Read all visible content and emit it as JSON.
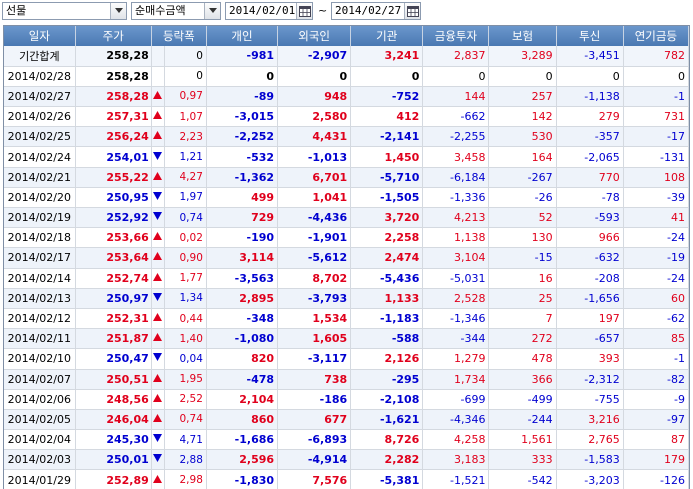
{
  "toolbar": {
    "market_select": "선물",
    "metric_select": "순매수금액",
    "date_from": "2014/02/01",
    "date_separator": "~",
    "date_to": "2014/02/27"
  },
  "colors": {
    "up": "#e0001c",
    "down": "#0000d0",
    "header": "#4f81bd"
  },
  "columns": [
    "일자",
    "주가",
    "등락폭",
    "개인",
    "외국인",
    "기관",
    "금융투자",
    "보험",
    "투신",
    "연기금등"
  ],
  "rows": [
    {
      "date": "기간합계",
      "price": "258,28",
      "dir": "",
      "chg": "0",
      "ind": "-981",
      "for": "-2,907",
      "inst": "3,241",
      "fin": "2,837",
      "ins": "3,289",
      "tru": "-3,451",
      "pen": "782",
      "sum": true
    },
    {
      "date": "2014/02/28",
      "price": "258,28",
      "dir": "",
      "chg": "0",
      "ind": "0",
      "for": "0",
      "inst": "0",
      "fin": "0",
      "ins": "0",
      "tru": "0",
      "pen": "0"
    },
    {
      "date": "2014/02/27",
      "price": "258,28",
      "dir": "up",
      "chg": "0,97",
      "ind": "-89",
      "for": "948",
      "inst": "-752",
      "fin": "144",
      "ins": "257",
      "tru": "-1,138",
      "pen": "-1"
    },
    {
      "date": "2014/02/26",
      "price": "257,31",
      "dir": "up",
      "chg": "1,07",
      "ind": "-3,015",
      "for": "2,580",
      "inst": "412",
      "fin": "-662",
      "ins": "142",
      "tru": "279",
      "pen": "731"
    },
    {
      "date": "2014/02/25",
      "price": "256,24",
      "dir": "up",
      "chg": "2,23",
      "ind": "-2,252",
      "for": "4,431",
      "inst": "-2,141",
      "fin": "-2,255",
      "ins": "530",
      "tru": "-357",
      "pen": "-17"
    },
    {
      "date": "2014/02/24",
      "price": "254,01",
      "dir": "down",
      "chg": "1,21",
      "ind": "-532",
      "for": "-1,013",
      "inst": "1,450",
      "fin": "3,458",
      "ins": "164",
      "tru": "-2,065",
      "pen": "-131"
    },
    {
      "date": "2014/02/21",
      "price": "255,22",
      "dir": "up",
      "chg": "4,27",
      "ind": "-1,362",
      "for": "6,701",
      "inst": "-5,710",
      "fin": "-6,184",
      "ins": "-267",
      "tru": "770",
      "pen": "108"
    },
    {
      "date": "2014/02/20",
      "price": "250,95",
      "dir": "down",
      "chg": "1,97",
      "ind": "499",
      "for": "1,041",
      "inst": "-1,505",
      "fin": "-1,336",
      "ins": "-26",
      "tru": "-78",
      "pen": "-39"
    },
    {
      "date": "2014/02/19",
      "price": "252,92",
      "dir": "down",
      "chg": "0,74",
      "ind": "729",
      "for": "-4,436",
      "inst": "3,720",
      "fin": "4,213",
      "ins": "52",
      "tru": "-593",
      "pen": "41"
    },
    {
      "date": "2014/02/18",
      "price": "253,66",
      "dir": "up",
      "chg": "0,02",
      "ind": "-190",
      "for": "-1,901",
      "inst": "2,258",
      "fin": "1,138",
      "ins": "130",
      "tru": "966",
      "pen": "-24"
    },
    {
      "date": "2014/02/17",
      "price": "253,64",
      "dir": "up",
      "chg": "0,90",
      "ind": "3,114",
      "for": "-5,612",
      "inst": "2,474",
      "fin": "3,104",
      "ins": "-15",
      "tru": "-632",
      "pen": "-19"
    },
    {
      "date": "2014/02/14",
      "price": "252,74",
      "dir": "up",
      "chg": "1,77",
      "ind": "-3,563",
      "for": "8,702",
      "inst": "-5,436",
      "fin": "-5,031",
      "ins": "16",
      "tru": "-208",
      "pen": "-24"
    },
    {
      "date": "2014/02/13",
      "price": "250,97",
      "dir": "down",
      "chg": "1,34",
      "ind": "2,895",
      "for": "-3,793",
      "inst": "1,133",
      "fin": "2,528",
      "ins": "25",
      "tru": "-1,656",
      "pen": "60"
    },
    {
      "date": "2014/02/12",
      "price": "252,31",
      "dir": "up",
      "chg": "0,44",
      "ind": "-348",
      "for": "1,534",
      "inst": "-1,183",
      "fin": "-1,346",
      "ins": "7",
      "tru": "197",
      "pen": "-62"
    },
    {
      "date": "2014/02/11",
      "price": "251,87",
      "dir": "up",
      "chg": "1,40",
      "ind": "-1,080",
      "for": "1,605",
      "inst": "-588",
      "fin": "-344",
      "ins": "272",
      "tru": "-657",
      "pen": "85"
    },
    {
      "date": "2014/02/10",
      "price": "250,47",
      "dir": "down",
      "chg": "0,04",
      "ind": "820",
      "for": "-3,117",
      "inst": "2,126",
      "fin": "1,279",
      "ins": "478",
      "tru": "393",
      "pen": "-1"
    },
    {
      "date": "2014/02/07",
      "price": "250,51",
      "dir": "up",
      "chg": "1,95",
      "ind": "-478",
      "for": "738",
      "inst": "-295",
      "fin": "1,734",
      "ins": "366",
      "tru": "-2,312",
      "pen": "-82"
    },
    {
      "date": "2014/02/06",
      "price": "248,56",
      "dir": "up",
      "chg": "2,52",
      "ind": "2,104",
      "for": "-186",
      "inst": "-2,108",
      "fin": "-699",
      "ins": "-499",
      "tru": "-755",
      "pen": "-9"
    },
    {
      "date": "2014/02/05",
      "price": "246,04",
      "dir": "up",
      "chg": "0,74",
      "ind": "860",
      "for": "677",
      "inst": "-1,621",
      "fin": "-4,346",
      "ins": "-244",
      "tru": "3,216",
      "pen": "-97"
    },
    {
      "date": "2014/02/04",
      "price": "245,30",
      "dir": "down",
      "chg": "4,71",
      "ind": "-1,686",
      "for": "-6,893",
      "inst": "8,726",
      "fin": "4,258",
      "ins": "1,561",
      "tru": "2,765",
      "pen": "87"
    },
    {
      "date": "2014/02/03",
      "price": "250,01",
      "dir": "down",
      "chg": "2,88",
      "ind": "2,596",
      "for": "-4,914",
      "inst": "2,282",
      "fin": "3,183",
      "ins": "333",
      "tru": "-1,583",
      "pen": "179"
    },
    {
      "date": "2014/01/29",
      "price": "252,89",
      "dir": "up",
      "chg": "2,98",
      "ind": "-1,830",
      "for": "7,576",
      "inst": "-5,381",
      "fin": "-1,521",
      "ins": "-542",
      "tru": "-3,203",
      "pen": "-126"
    }
  ]
}
